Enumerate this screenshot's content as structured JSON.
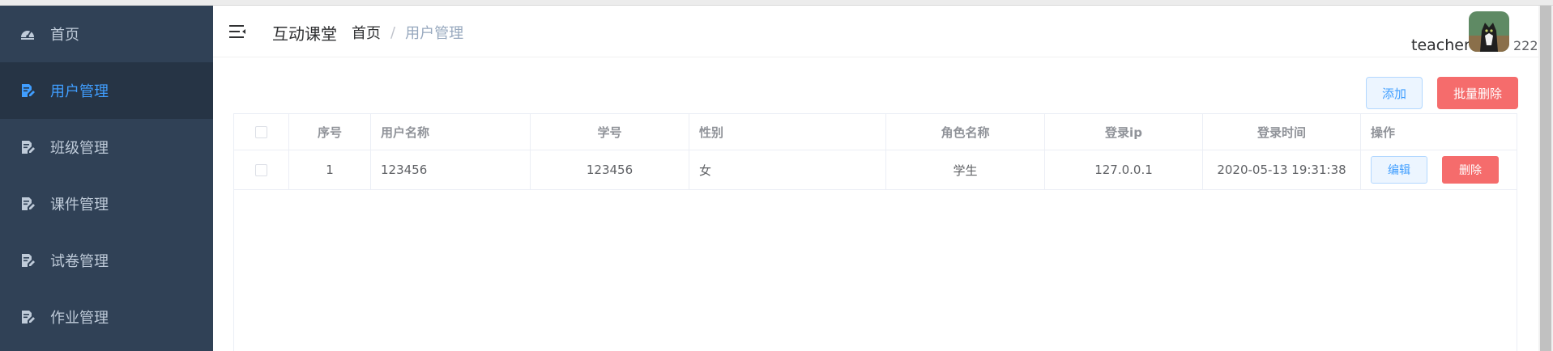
{
  "sidebar": {
    "items": [
      {
        "label": "首页",
        "icon": "dashboard-icon",
        "active": false
      },
      {
        "label": "用户管理",
        "icon": "edit-doc-icon",
        "active": true
      },
      {
        "label": "班级管理",
        "icon": "edit-doc-icon",
        "active": false
      },
      {
        "label": "课件管理",
        "icon": "edit-doc-icon",
        "active": false
      },
      {
        "label": "试卷管理",
        "icon": "edit-doc-icon",
        "active": false
      },
      {
        "label": "作业管理",
        "icon": "edit-doc-icon",
        "active": false
      }
    ]
  },
  "header": {
    "app_title": "互动课堂",
    "breadcrumb": {
      "home": "首页",
      "separator": "/",
      "current": "用户管理"
    },
    "user": {
      "name": "teacher",
      "number": "222"
    }
  },
  "toolbar": {
    "add_label": "添加",
    "batch_delete_label": "批量删除"
  },
  "table": {
    "columns": [
      "序号",
      "用户名称",
      "学号",
      "性别",
      "角色名称",
      "登录ip",
      "登录时间",
      "操作"
    ],
    "rows": [
      {
        "index": "1",
        "username": "123456",
        "student_id": "123456",
        "gender": "女",
        "role": "学生",
        "login_ip": "127.0.0.1",
        "login_time": "2020-05-13 19:31:38",
        "edit_label": "编辑",
        "delete_label": "删除"
      }
    ]
  },
  "colors": {
    "sidebar_bg": "#304156",
    "sidebar_active_bg": "#263445",
    "sidebar_text": "#bfcbd9",
    "accent": "#409eff",
    "danger": "#f56c6c"
  }
}
